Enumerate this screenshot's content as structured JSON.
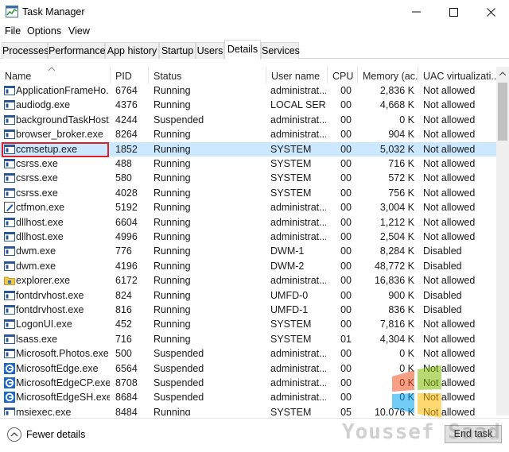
{
  "window": {
    "title": "Task Manager"
  },
  "menu": {
    "file": "File",
    "options": "Options",
    "view": "View"
  },
  "tabs": [
    "Processes",
    "Performance",
    "App history",
    "Startup",
    "Users",
    "Details",
    "Services"
  ],
  "active_tab": "Details",
  "columns": [
    "Name",
    "PID",
    "Status",
    "User name",
    "CPU",
    "Memory (ac...",
    "UAC virtualizati..."
  ],
  "sorted_column": "Name",
  "rows": [
    {
      "name": "ApplicationFrameHo...",
      "pid": "6764",
      "status": "Running",
      "user": "administrat...",
      "cpu": "00",
      "mem": "2,836 K",
      "uac": "Not allowed",
      "icon": "app-window-icon"
    },
    {
      "name": "audiodg.exe",
      "pid": "4376",
      "status": "Running",
      "user": "LOCAL SER...",
      "cpu": "00",
      "mem": "4,668 K",
      "uac": "Not allowed",
      "icon": "app-window-icon"
    },
    {
      "name": "backgroundTaskHost...",
      "pid": "4244",
      "status": "Suspended",
      "user": "administrat...",
      "cpu": "00",
      "mem": "0 K",
      "uac": "Not allowed",
      "icon": "app-window-icon"
    },
    {
      "name": "browser_broker.exe",
      "pid": "8264",
      "status": "Running",
      "user": "administrat...",
      "cpu": "00",
      "mem": "904 K",
      "uac": "Not allowed",
      "icon": "app-window-icon"
    },
    {
      "name": "ccmsetup.exe",
      "pid": "1852",
      "status": "Running",
      "user": "SYSTEM",
      "cpu": "00",
      "mem": "5,032 K",
      "uac": "Not allowed",
      "icon": "app-window-icon"
    },
    {
      "name": "csrss.exe",
      "pid": "488",
      "status": "Running",
      "user": "SYSTEM",
      "cpu": "00",
      "mem": "716 K",
      "uac": "Not allowed",
      "icon": "app-window-icon"
    },
    {
      "name": "csrss.exe",
      "pid": "580",
      "status": "Running",
      "user": "SYSTEM",
      "cpu": "00",
      "mem": "572 K",
      "uac": "Not allowed",
      "icon": "app-window-icon"
    },
    {
      "name": "csrss.exe",
      "pid": "4028",
      "status": "Running",
      "user": "SYSTEM",
      "cpu": "00",
      "mem": "756 K",
      "uac": "Not allowed",
      "icon": "app-window-icon"
    },
    {
      "name": "ctfmon.exe",
      "pid": "5192",
      "status": "Running",
      "user": "administrat...",
      "cpu": "00",
      "mem": "3,004 K",
      "uac": "Not allowed",
      "icon": "pen-icon"
    },
    {
      "name": "dllhost.exe",
      "pid": "6604",
      "status": "Running",
      "user": "administrat...",
      "cpu": "00",
      "mem": "1,212 K",
      "uac": "Not allowed",
      "icon": "app-window-icon"
    },
    {
      "name": "dllhost.exe",
      "pid": "4996",
      "status": "Running",
      "user": "administrat...",
      "cpu": "00",
      "mem": "2,504 K",
      "uac": "Not allowed",
      "icon": "app-window-icon"
    },
    {
      "name": "dwm.exe",
      "pid": "776",
      "status": "Running",
      "user": "DWM-1",
      "cpu": "00",
      "mem": "8,284 K",
      "uac": "Disabled",
      "icon": "app-window-icon"
    },
    {
      "name": "dwm.exe",
      "pid": "4196",
      "status": "Running",
      "user": "DWM-2",
      "cpu": "00",
      "mem": "48,772 K",
      "uac": "Disabled",
      "icon": "app-window-icon"
    },
    {
      "name": "explorer.exe",
      "pid": "6172",
      "status": "Running",
      "user": "administrat...",
      "cpu": "00",
      "mem": "16,836 K",
      "uac": "Not allowed",
      "icon": "folder-icon"
    },
    {
      "name": "fontdrvhost.exe",
      "pid": "824",
      "status": "Running",
      "user": "UMFD-0",
      "cpu": "00",
      "mem": "900 K",
      "uac": "Disabled",
      "icon": "app-window-icon"
    },
    {
      "name": "fontdrvhost.exe",
      "pid": "816",
      "status": "Running",
      "user": "UMFD-1",
      "cpu": "00",
      "mem": "836 K",
      "uac": "Disabled",
      "icon": "app-window-icon"
    },
    {
      "name": "LogonUI.exe",
      "pid": "452",
      "status": "Running",
      "user": "SYSTEM",
      "cpu": "00",
      "mem": "7,816 K",
      "uac": "Not allowed",
      "icon": "app-window-icon"
    },
    {
      "name": "lsass.exe",
      "pid": "716",
      "status": "Running",
      "user": "SYSTEM",
      "cpu": "01",
      "mem": "4,304 K",
      "uac": "Not allowed",
      "icon": "app-window-icon"
    },
    {
      "name": "Microsoft.Photos.exe",
      "pid": "500",
      "status": "Suspended",
      "user": "administrat...",
      "cpu": "00",
      "mem": "0 K",
      "uac": "Not allowed",
      "icon": "app-window-icon"
    },
    {
      "name": "MicrosoftEdge.exe",
      "pid": "6564",
      "status": "Suspended",
      "user": "administrat...",
      "cpu": "00",
      "mem": "0 K",
      "uac": "Not allowed",
      "icon": "edge-icon"
    },
    {
      "name": "MicrosoftEdgeCP.exe",
      "pid": "8708",
      "status": "Suspended",
      "user": "administrat...",
      "cpu": "00",
      "mem": "0 K",
      "uac": "Not allowed",
      "icon": "edge-icon"
    },
    {
      "name": "MicrosoftEdgeSH.exe",
      "pid": "8684",
      "status": "Suspended",
      "user": "administrat...",
      "cpu": "00",
      "mem": "0 K",
      "uac": "Not allowed",
      "icon": "edge-icon"
    },
    {
      "name": "msiexec.exe",
      "pid": "8484",
      "status": "Running",
      "user": "SYSTEM",
      "cpu": "05",
      "mem": "10,076 K",
      "uac": "Not allowed",
      "icon": "app-window-icon"
    }
  ],
  "selected_row": "ccmsetup.exe",
  "footer": {
    "fewer_details": "Fewer details",
    "end_task": "End task"
  },
  "watermark": "Youssef Saad",
  "colors": {
    "selection": "#cce8ff",
    "highlight_border": "#d9232b",
    "icon_blue": "#1f5ba8"
  }
}
